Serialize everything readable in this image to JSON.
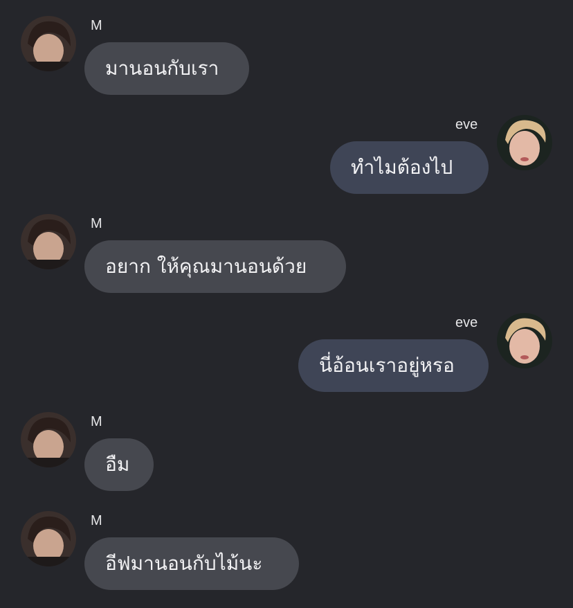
{
  "colors": {
    "background": "#25262b",
    "bubble_received": "#46484f",
    "bubble_sent": "#3f4556",
    "text": "#f2f2f4"
  },
  "messages": [
    {
      "sender": "M",
      "text": "มานอนกับเรา",
      "side": "left"
    },
    {
      "sender": "eve",
      "text": "ทำไมต้องไป",
      "side": "right"
    },
    {
      "sender": "M",
      "text": "อยาก ให้คุณมานอนด้วย",
      "side": "left"
    },
    {
      "sender": "eve",
      "text": "นี่อ้อนเราอยู่หรอ",
      "side": "right"
    },
    {
      "sender": "M",
      "text": "อืม",
      "side": "left"
    },
    {
      "sender": "M",
      "text": "อีฟมานอนกับไม้นะ",
      "side": "left"
    }
  ]
}
